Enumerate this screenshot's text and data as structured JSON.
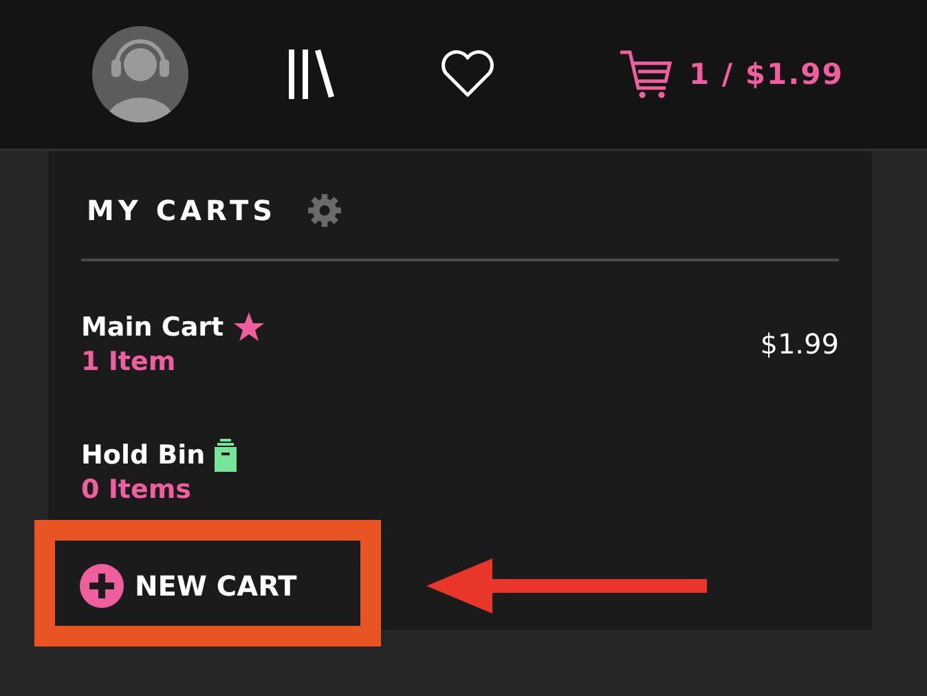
{
  "top_bar": {
    "cart_summary": "1 / $1.99"
  },
  "carts_menu": {
    "title": "MY CARTS",
    "carts": [
      {
        "name": "Main Cart",
        "kind": "star",
        "count": "1 Item",
        "total": "$1.99"
      },
      {
        "name": "Hold Bin",
        "kind": "bin",
        "count": "0 Items"
      }
    ],
    "new_cart_button": "NEW CART"
  }
}
